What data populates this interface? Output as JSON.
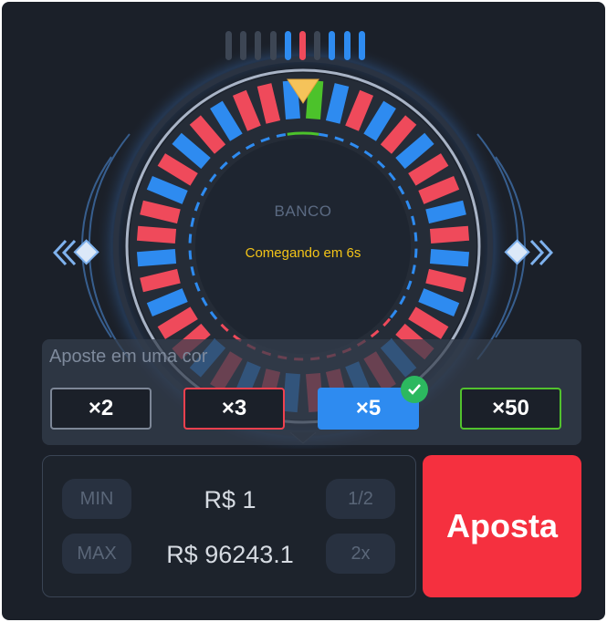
{
  "history": {
    "results": [
      "none",
      "none",
      "none",
      "none",
      "blue",
      "red",
      "none",
      "blue",
      "blue",
      "blue"
    ]
  },
  "wheel": {
    "center_label": "BANCO",
    "countdown": "Comegando em 6s",
    "segments": [
      "blue",
      "green",
      "blue",
      "red",
      "blue",
      "red",
      "blue",
      "red",
      "red",
      "blue",
      "red",
      "blue",
      "red",
      "blue",
      "red",
      "red",
      "blue",
      "red",
      "blue",
      "red",
      "red",
      "blue",
      "red",
      "blue",
      "red",
      "blue",
      "red",
      "red",
      "blue",
      "red",
      "blue",
      "red",
      "red",
      "blue",
      "red",
      "blue",
      "red",
      "blue",
      "red",
      "red"
    ]
  },
  "bet": {
    "prompt": "Aposte em uma cor",
    "multipliers": [
      {
        "label": "×2",
        "color": "#7d8797",
        "selected": false
      },
      {
        "label": "×3",
        "color": "#f0404e",
        "selected": false
      },
      {
        "label": "×5",
        "color": "#2e8bf0",
        "selected": true
      },
      {
        "label": "×50",
        "color": "#52c22d",
        "selected": false
      }
    ]
  },
  "amount": {
    "min_label": "MIN",
    "max_label": "MAX",
    "value": "R$  1",
    "max_value": "R$ 96243.1",
    "half_label": "1/2",
    "double_label": "2x"
  },
  "place_bet_label": "Aposta",
  "colors": {
    "red": "#ef4a5b",
    "blue": "#2e8bf0",
    "green": "#4cc22b",
    "pointer": "#f5c35a",
    "bet_button": "#f5303f",
    "history_idle": "#3d4654"
  }
}
